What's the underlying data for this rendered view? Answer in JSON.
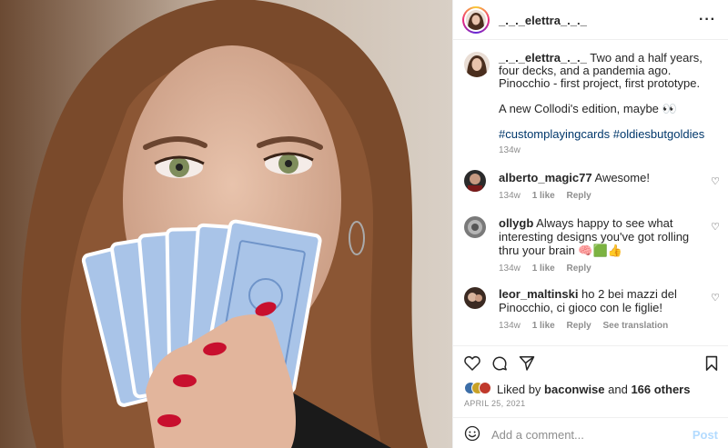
{
  "post": {
    "username": "_._._elettra_._._",
    "more_icon": "more-horizontal-icon"
  },
  "caption": {
    "username": "_._._elettra_._._",
    "line1": " Two and a half years, four decks, and a pandemia ago.",
    "line2": "Pinocchio - first project, first prototype.",
    "line3": "A new Collodi's edition, maybe 👀",
    "hashtags": "#customplayingcards #oldiesbutgoldies",
    "time": "134w"
  },
  "comments": [
    {
      "user": "alberto_magic77",
      "text": " Awesome!",
      "time": "134w",
      "likes": "1 like",
      "reply": "Reply",
      "translate": ""
    },
    {
      "user": "ollygb",
      "text": " Always happy to see what interesting designs you've got rolling thru your brain 🧠🟩👍",
      "time": "134w",
      "likes": "1 like",
      "reply": "Reply",
      "translate": ""
    },
    {
      "user": "leor_maltinski",
      "text": " ho 2 bei mazzi del Pinocchio, ci gioco con le figlie!",
      "time": "134w",
      "likes": "1 like",
      "reply": "Reply",
      "translate": "See translation"
    }
  ],
  "likes": {
    "prefix": "Liked by ",
    "user": "baconwise",
    "mid": " and ",
    "count": "166 others"
  },
  "date": "APRIL 25, 2021",
  "comment_box": {
    "placeholder": "Add a comment...",
    "post_label": "Post",
    "emoji_icon": "emoji-icon"
  },
  "colors": {
    "link": "#00376b",
    "muted": "#8e8e8e",
    "post_disabled": "#b3dbff"
  }
}
